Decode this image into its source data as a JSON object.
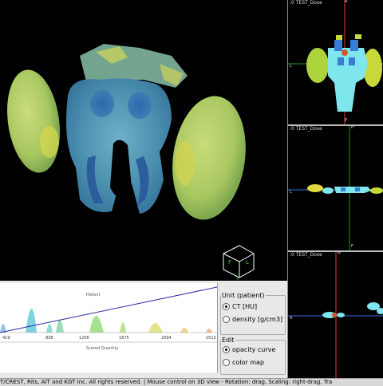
{
  "ortho_views": [
    {
      "label": ":0  TEST_Dose",
      "axis_top": "A",
      "axis_bottom": "P",
      "axis_left": "L"
    },
    {
      "label": ":0  TEST_Dose",
      "axis_top": "H",
      "axis_bottom": "F",
      "axis_left": "L"
    },
    {
      "label": ":0  TEST_Dose",
      "axis_top": "H",
      "axis_bottom": "",
      "axis_left": "A"
    }
  ],
  "orientation_cube": {
    "face_front": "F",
    "face_right": "L",
    "face_bottom": "P"
  },
  "curve_panel": {
    "top_title": "Patient",
    "bottom_title": "Scored Quantity",
    "x_ticks": [
      "419",
      "838",
      "1256",
      "1675",
      "2094",
      "2513"
    ]
  },
  "unit_group": {
    "title": "Unit (patient)",
    "options": [
      "CT [HU]",
      "density [g/cm3]"
    ],
    "selected": 0
  },
  "edit_group": {
    "title": "Edit",
    "options": [
      "opacity curve",
      "color map"
    ],
    "selected": 0
  },
  "status_bar": {
    "text": "T/CREST, Rits, AIT and KGT Inc. All rights reserved.  | Mouse control on 3D view -  Rotation: drag,  Scaling: right-drag,  Tra"
  }
}
